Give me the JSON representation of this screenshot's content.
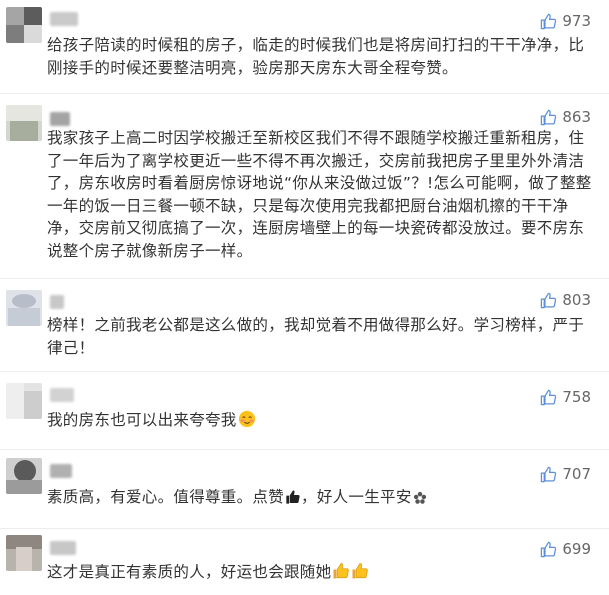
{
  "comments": [
    {
      "likes": "973",
      "text": "给孩子陪读的时候租的房子，临走的时候我们也是将房间打扫的干干净净，比刚接手的时候还要整洁明亮，验房那天房东大哥全程夸赞。",
      "emoji": []
    },
    {
      "likes": "863",
      "text": "我家孩子上高二时因学校搬迁至新校区我们不得不跟随学校搬迁重新租房，住了一年后为了离学校更近一些不得不再次搬迁，交房前我把房子里里外外清洁了，房东收房时看着厨房惊讶地说“你从来没做过饭”？!怎么可能啊，做了整整一年的饭一日三餐一顿不缺，只是每次使用完我都把厨台油烟机擦的干干净净，交房前又彻底搞了一次，连厨房墙壁上的每一块瓷砖都没放过。要不房东说整个房子就像新房子一样。",
      "emoji": []
    },
    {
      "likes": "803",
      "text": "榜样！之前我老公都是这么做的，我却觉着不用做得那么好。学习榜样，严于律己！",
      "emoji": []
    },
    {
      "likes": "758",
      "text": "我的房东也可以出来夸夸我",
      "emoji": [
        "blush-face"
      ]
    },
    {
      "likes": "707",
      "text": "素质高，有爱心。值得尊重。点赞",
      "text2": "，好人一生平安",
      "emoji": [
        "thumbs-up-dark",
        "flower"
      ]
    },
    {
      "likes": "699",
      "text": "这才是真正有素质的人，好运也会跟随她",
      "emoji": [
        "thumbs-up",
        "thumbs-up"
      ]
    }
  ],
  "colors": {
    "like_icon": "#5b8fd9",
    "text": "#333333",
    "likes_text": "#666666",
    "divider": "#ededed"
  }
}
